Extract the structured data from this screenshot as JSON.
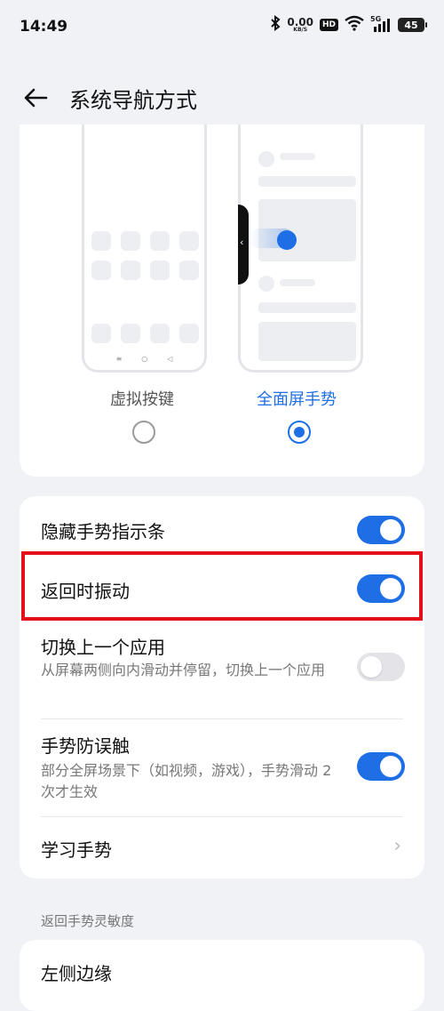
{
  "status_bar": {
    "time": "14:49",
    "net_speed_value": "0.00",
    "net_speed_unit": "KB/S",
    "hd_label": "HD",
    "signal_label": "5G",
    "battery_level": "45"
  },
  "header": {
    "title": "系统导航方式"
  },
  "preview": {
    "modes": [
      {
        "label": "虚拟按键",
        "selected": false
      },
      {
        "label": "全面屏手势",
        "selected": true
      }
    ]
  },
  "settings": {
    "rows": [
      {
        "title": "隐藏手势指示条",
        "toggle": true
      },
      {
        "title": "返回时振动",
        "toggle": true
      },
      {
        "title": "切换上一个应用",
        "subtitle": "从屏幕两侧向内滑动并停留，切换上一个应用",
        "toggle": false
      },
      {
        "title": "手势防误触",
        "subtitle": "部分全屏场景下（如视频，游戏），手势滑动 2 次才生效",
        "toggle": true
      },
      {
        "title": "学习手势"
      }
    ]
  },
  "section": {
    "label": "返回手势灵敏度"
  },
  "bottom": {
    "first_item": "左侧边缘"
  },
  "colors": {
    "accent": "#1e6ee6",
    "highlight": "#e3101a",
    "background": "#f1f2f6"
  }
}
